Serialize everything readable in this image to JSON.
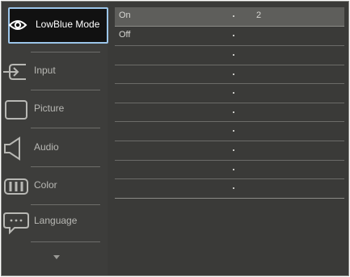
{
  "menu": {
    "items": [
      {
        "label": "LowBlue Mode",
        "icon": "eye-icon",
        "selected": true
      },
      {
        "label": "Input",
        "icon": "input-icon",
        "selected": false
      },
      {
        "label": "Picture",
        "icon": "picture-icon",
        "selected": false
      },
      {
        "label": "Audio",
        "icon": "speaker-icon",
        "selected": false
      },
      {
        "label": "Color",
        "icon": "color-icon",
        "selected": false
      },
      {
        "label": "Language",
        "icon": "speech-bubble-icon",
        "selected": false
      }
    ],
    "more_icon": "chevron-down-icon"
  },
  "submenu": {
    "rows": [
      {
        "label": "On",
        "value": "2"
      },
      {
        "label": "Off",
        "value": ""
      },
      {
        "label": "",
        "value": ""
      },
      {
        "label": "",
        "value": ""
      },
      {
        "label": "",
        "value": ""
      },
      {
        "label": "",
        "value": ""
      },
      {
        "label": "",
        "value": ""
      },
      {
        "label": "",
        "value": ""
      },
      {
        "label": "",
        "value": ""
      },
      {
        "label": "",
        "value": ""
      }
    ]
  },
  "colors": {
    "selected_border": "#9bc4e8",
    "background": "#3a3a38"
  }
}
